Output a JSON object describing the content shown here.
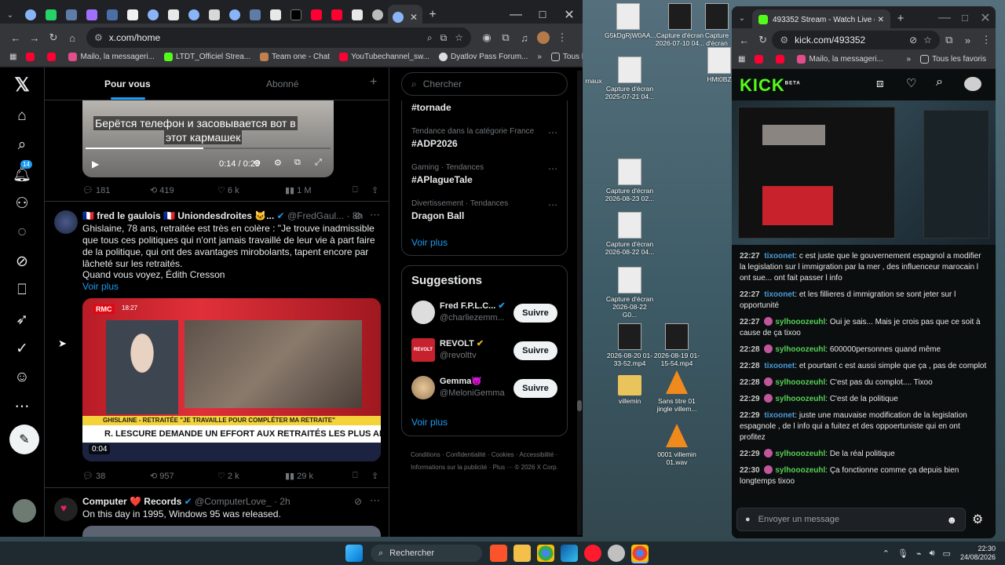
{
  "desktop": {
    "icons": [
      {
        "label": "Capture d'écran 2026-07-10 04...",
        "kind": "dark"
      },
      {
        "label": "Capture d'écran",
        "kind": "light"
      },
      {
        "label": "Capture d'écran 2025-07-21 04...",
        "kind": "light"
      },
      {
        "label": "Capture d'écran 2026-08-23 02...",
        "kind": "light"
      },
      {
        "label": "Capture d'écran 2026-08-22 04...",
        "kind": "light"
      },
      {
        "label": "Capture d'écran 2026-08-22 G0...",
        "kind": "light"
      },
      {
        "label": "2026-08-20 01-33-52.mp4",
        "kind": "dark"
      },
      {
        "label": "2026-08-19 01-15-54.mp4",
        "kind": "dark"
      },
      {
        "label": "villemin",
        "kind": "folder"
      },
      {
        "label": "Sans titre 01 jingle villem...",
        "kind": "cone"
      },
      {
        "label": "0001 villemin 01.wav",
        "kind": "cone"
      },
      {
        "label": "HMt0BZ",
        "kind": "light"
      },
      {
        "label": "G5kDgRjW0AA...",
        "kind": "light"
      },
      {
        "label": "rnaux",
        "kind": "light"
      }
    ]
  },
  "x_window": {
    "tab_count_icons": [
      "chrome",
      "chrome",
      "whatsapp",
      "chrome",
      "app",
      "app",
      "notion",
      "chrome",
      "w",
      "chrome",
      "g",
      "chrome",
      "chrome",
      "w",
      "x",
      "youtube",
      "youtube",
      "w",
      "github",
      "chrome"
    ],
    "url": "x.com/home",
    "bookmarks": [
      "",
      "",
      "Mailo, la messageri...",
      "LTDT_Officiel Strea...",
      "Team one - Chat",
      "YouTubechannel_sw...",
      "Dyatlov Pass Forum..."
    ],
    "all_bookmarks": "Tous les favoris",
    "tabs": {
      "for_you": "Pour vous",
      "following": "Abonné"
    },
    "video1": {
      "caption_line1": "Берётся телефон и засовывается вот в",
      "caption_line2": "этот кармашек",
      "time": "0:14 / 0:29"
    },
    "post1_actions": {
      "replies": "181",
      "reposts": "419",
      "likes": "6 k",
      "views": "1 M"
    },
    "post2": {
      "author": "🇫🇷 fred le gaulois 🇫🇷 Uniondesdroites 🐱...",
      "handle": "@FredGaul...",
      "age": "· 8h",
      "text": "Ghislaine, 78 ans, retraitée est très en colère : \"Je trouve inadmissible que tous ces politiques qui n'ont jamais travaillé de leur vie à part faire de la politique, qui ont des avantages mirobolants, tapent encore par lâcheté sur les retraités.",
      "text2": "Quand vous voyez, Édith Cresson",
      "more": "Voir plus",
      "video_duration": "0:04",
      "banner_name": "GHISLAINE - RETRAITÉE",
      "banner_quote": "\"JE TRAVAILLE POUR COMPLÉTER MA RETRAITE\"",
      "headline": "R. LESCURE DEMANDE UN EFFORT AUX RETRAITÉS LES PLUS AISÉS",
      "channel": "RMC",
      "clock": "18:27",
      "actions": {
        "replies": "38",
        "reposts": "957",
        "likes": "2 k",
        "views": "29 k"
      }
    },
    "post3": {
      "author": "Computer ❤️ Records",
      "handle": "@ComputerLove_",
      "age": "· 2h",
      "text": "On this day in 1995, Windows 95 was released."
    },
    "search_placeholder": "Chercher",
    "trends": [
      {
        "context": "",
        "name": "#tornade"
      },
      {
        "context": "Tendance dans la catégorie France",
        "name": "#ADP2026"
      },
      {
        "context": "Gaming · Tendances",
        "name": "#APlagueTale"
      },
      {
        "context": "Divertissement · Tendances",
        "name": "Dragon Ball"
      }
    ],
    "trends_more": "Voir plus",
    "suggestions_title": "Suggestions",
    "suggestions": [
      {
        "name": "Fred F.P.L.C...",
        "handle": "@charliezemm...",
        "button": "Suivre"
      },
      {
        "name": "REVOLT",
        "handle": "@revolttv",
        "button": "Suivre"
      },
      {
        "name": "Gemma😈",
        "handle": "@MeloniGemma",
        "button": "Suivre"
      }
    ],
    "suggestions_more": "Voir plus",
    "footer": [
      "Conditions",
      "Confidentialité",
      "Cookies",
      "Accessibilité",
      "Informations sur la publicité",
      "Plus ···",
      "© 2026 X Corp."
    ]
  },
  "kick_window": {
    "tab_title": "493352 Stream - Watch Live on",
    "url": "kick.com/493352",
    "bookmarks": [
      "Mailo, la messageri...",
      "Tous les favoris"
    ],
    "logo": "KICK",
    "logo_beta": "BETA",
    "chat": [
      {
        "time": "22:27",
        "user": "tixoonet",
        "badge": false,
        "msg": "c est juste que le gouvernement espagnol a modifier la legislation sur l immigration par la mer , des influenceur marocain l ont sue... ont fait passer l info"
      },
      {
        "time": "22:27",
        "user": "tixoonet",
        "badge": false,
        "msg": "et les fillieres d immigration se sont jeter sur l opportunité"
      },
      {
        "time": "22:27",
        "user": "sylhooozeuhl",
        "badge": true,
        "msg": "Oui je sais... Mais je crois pas que ce soit à cause de ça tixoo"
      },
      {
        "time": "22:28",
        "user": "sylhooozeuhl",
        "badge": true,
        "msg": "600000personnes quand même"
      },
      {
        "time": "22:28",
        "user": "tixoonet",
        "badge": false,
        "msg": "et pourtant c est aussi simple que ça , pas de complot"
      },
      {
        "time": "22:28",
        "user": "sylhooozeuhl",
        "badge": true,
        "msg": "C'est pas du complot.... Tixoo"
      },
      {
        "time": "22:29",
        "user": "sylhooozeuhl",
        "badge": true,
        "msg": "C'est de la politique"
      },
      {
        "time": "22:29",
        "user": "tixoonet",
        "badge": false,
        "msg": "juste une mauvaise modification de la legislation espagnole , de l info qui a fuitez et des oppoertuniste qui en ont profitez"
      },
      {
        "time": "22:29",
        "user": "sylhooozeuhl",
        "badge": true,
        "msg": "De la réal politique"
      },
      {
        "time": "22:30",
        "user": "sylhooozeuhl",
        "badge": true,
        "msg": "Ça fonctionne comme ça depuis bien longtemps tixoo"
      }
    ],
    "input_placeholder": "Envoyer un message"
  },
  "taskbar": {
    "search": "Rechercher",
    "time": "22:30",
    "date": "24/08/2026"
  },
  "colors": {
    "x_blue": "#1d9bf0",
    "kick_green": "#53fc18",
    "follow_bg": "#eff3f4"
  }
}
